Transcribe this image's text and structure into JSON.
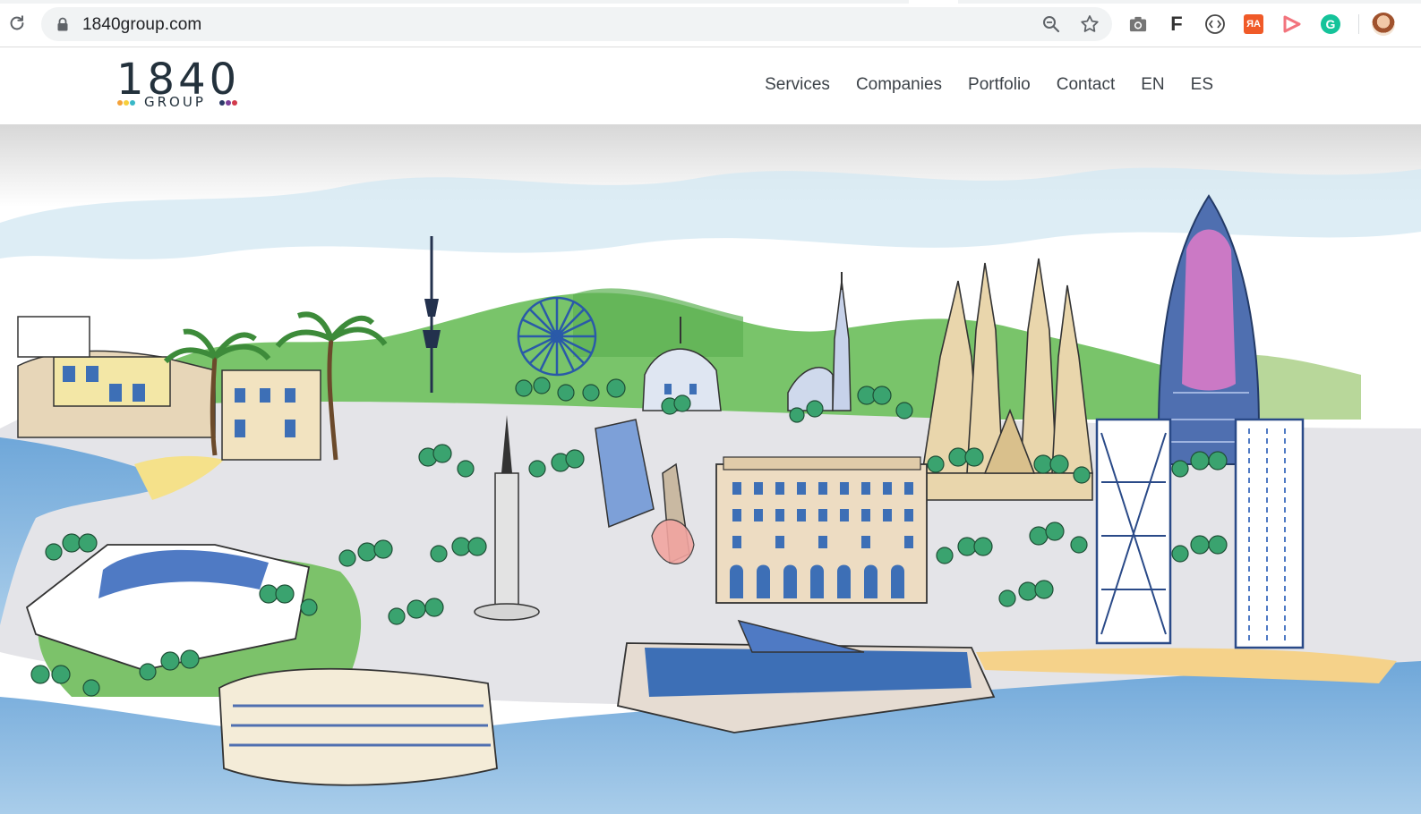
{
  "browser": {
    "url": "1840group.com",
    "extensions": [
      "camera-icon",
      "f-extension-icon",
      "code-extension-icon",
      "translate-extension-icon",
      "play-extension-icon",
      "grammarly-icon"
    ],
    "extension_text": {
      "f": "F",
      "translate": "ЯA",
      "grammarly": "G"
    }
  },
  "site": {
    "logo": {
      "number": "1840",
      "word": "GROUP"
    },
    "nav": [
      {
        "label": "Services"
      },
      {
        "label": "Companies"
      },
      {
        "label": "Portfolio"
      },
      {
        "label": "Contact"
      },
      {
        "label": "EN"
      },
      {
        "label": "ES"
      }
    ],
    "colors": {
      "logo_dark": "#23313c",
      "dot_orange": "#f4a23a",
      "dot_yellow": "#f7cf3c",
      "dot_teal": "#38b7c7",
      "dot_navy": "#2b3a67",
      "dot_purple": "#7b3f9a",
      "dot_red": "#d23a4b"
    }
  },
  "hero": {
    "subject": "barcelona-skyline-illustration"
  }
}
